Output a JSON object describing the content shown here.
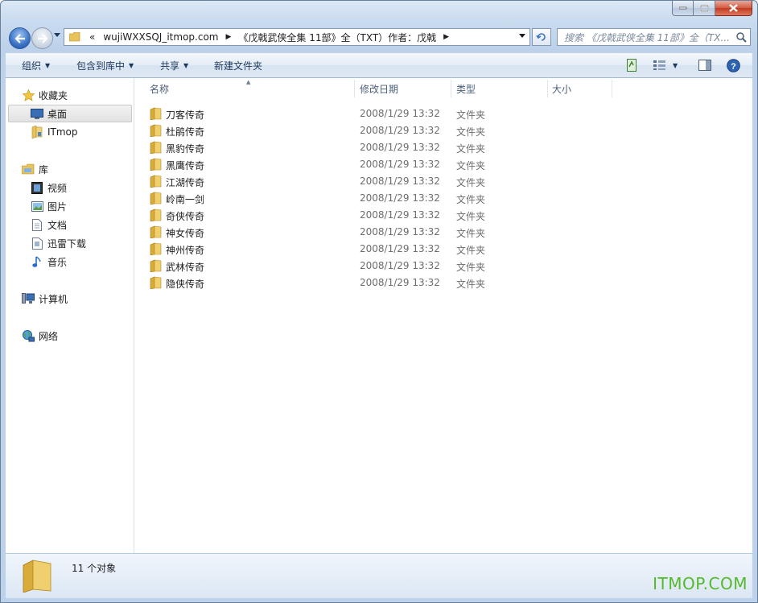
{
  "caption": {
    "minimize": "minimize",
    "maximize": "maximize",
    "close": "close"
  },
  "address": {
    "overflow": "«",
    "segments": [
      "wujiWXXSQJ_itmop.com",
      "《戊戟武侠全集 11部》全（TXT）作者：戊戟"
    ]
  },
  "search": {
    "placeholder": "搜索 《戊戟武侠全集 11部》全（TX..."
  },
  "toolbar": {
    "organize": "组织",
    "include_in_library": "包含到库中",
    "share": "共享",
    "new_folder": "新建文件夹"
  },
  "sidebar": {
    "favorites": "收藏夹",
    "desktop": "桌面",
    "itmop": "ITmop",
    "libraries": "库",
    "videos": "视频",
    "pictures": "图片",
    "documents": "文档",
    "thunder": "迅雷下载",
    "music": "音乐",
    "computer": "计算机",
    "network": "网络"
  },
  "columns": {
    "name": "名称",
    "date": "修改日期",
    "type": "类型",
    "size": "大小"
  },
  "files": [
    {
      "name": "刀客传奇",
      "date": "2008/1/29 13:32",
      "type": "文件夹"
    },
    {
      "name": "杜鹃传奇",
      "date": "2008/1/29 13:32",
      "type": "文件夹"
    },
    {
      "name": "黑豹传奇",
      "date": "2008/1/29 13:32",
      "type": "文件夹"
    },
    {
      "name": "黑鹰传奇",
      "date": "2008/1/29 13:32",
      "type": "文件夹"
    },
    {
      "name": "江湖传奇",
      "date": "2008/1/29 13:32",
      "type": "文件夹"
    },
    {
      "name": "岭南一剑",
      "date": "2008/1/29 13:32",
      "type": "文件夹"
    },
    {
      "name": "奇侠传奇",
      "date": "2008/1/29 13:32",
      "type": "文件夹"
    },
    {
      "name": "神女传奇",
      "date": "2008/1/29 13:32",
      "type": "文件夹"
    },
    {
      "name": "神州传奇",
      "date": "2008/1/29 13:32",
      "type": "文件夹"
    },
    {
      "name": "武林传奇",
      "date": "2008/1/29 13:32",
      "type": "文件夹"
    },
    {
      "name": "隐侠传奇",
      "date": "2008/1/29 13:32",
      "type": "文件夹"
    }
  ],
  "status": {
    "count": "11 个对象"
  },
  "watermark": "ITMOP.COM",
  "colors": {
    "folder": "#e8c25a",
    "accent": "#3b73c6",
    "watermark": "#55b92c"
  }
}
